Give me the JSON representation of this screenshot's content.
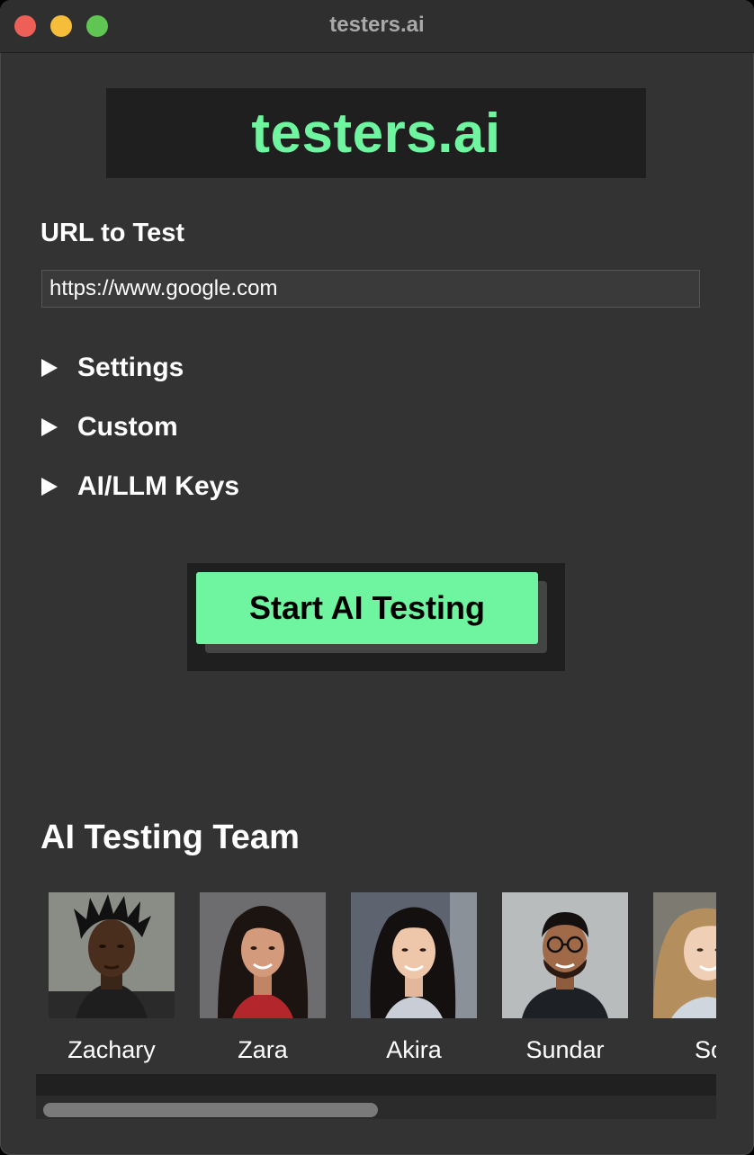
{
  "window": {
    "title": "testers.ai"
  },
  "logo": {
    "text": "testers.ai"
  },
  "url": {
    "label": "URL to Test",
    "value": "https://www.google.com"
  },
  "sections": [
    {
      "label": "Settings"
    },
    {
      "label": "Custom"
    },
    {
      "label": "AI/LLM Keys"
    }
  ],
  "start_button": {
    "label": "Start AI Testing"
  },
  "team": {
    "title": "AI Testing Team",
    "members": [
      {
        "name": "Zachary"
      },
      {
        "name": "Zara"
      },
      {
        "name": "Akira"
      },
      {
        "name": "Sundar"
      },
      {
        "name": "Sop"
      }
    ]
  },
  "colors": {
    "accent": "#6ff49f",
    "window_bg": "#333333",
    "panel_bg": "#1f1f1f"
  }
}
